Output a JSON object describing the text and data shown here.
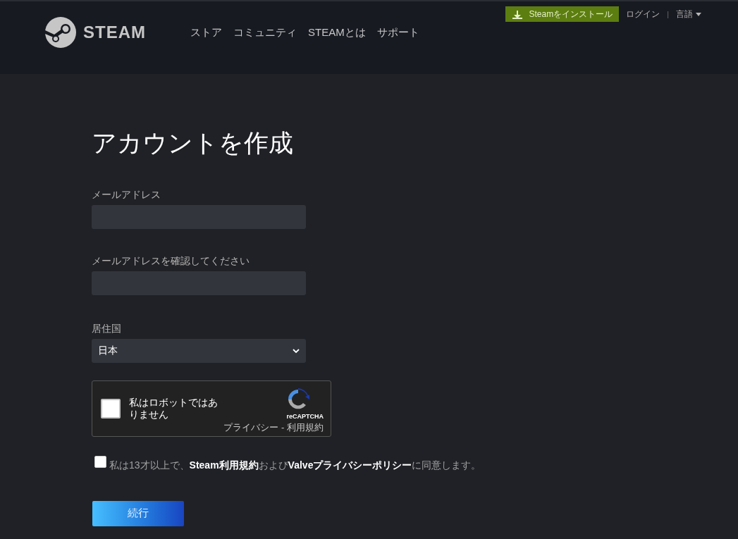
{
  "header": {
    "logo_text": "STEAM",
    "nav": [
      "ストア",
      "コミュニティ",
      "STEAMとは",
      "サポート"
    ],
    "install_button": "Steamをインストール",
    "login": "ログイン",
    "separator": "|",
    "language": "言語"
  },
  "form": {
    "title": "アカウントを作成",
    "email": {
      "label": "メールアドレス"
    },
    "confirm_email": {
      "label": "メールアドレスを確認してください"
    },
    "country": {
      "label": "居住国",
      "value": "日本"
    },
    "captcha": {
      "checked": false,
      "label": "私はロボットではありません",
      "brand": "reCAPTCHA",
      "links": "プライバシー - 利用規約"
    },
    "agreement": {
      "checked": false,
      "parts": [
        {
          "kind": "text",
          "text": "私は13才以上で、"
        },
        {
          "kind": "link",
          "text": "Steam利用規約"
        },
        {
          "kind": "text",
          "text": "および"
        },
        {
          "kind": "link",
          "text": "Valveプライバシーポリシー"
        },
        {
          "kind": "text",
          "text": "に同意します。"
        }
      ]
    },
    "submit": "続行"
  }
}
